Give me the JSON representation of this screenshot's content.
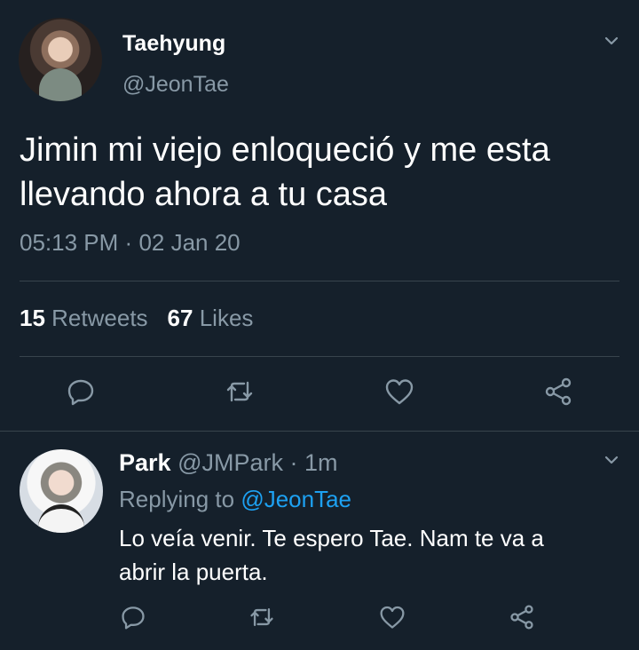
{
  "main_tweet": {
    "author_name": "Taehyung",
    "author_handle": "@JeonTae",
    "text": "Jimin mi viejo enloqueció y me esta\nllevando ahora a tu casa",
    "time": "05:13 PM",
    "separator": "·",
    "date": "02 Jan 20",
    "retweets_count": "15",
    "retweets_label": "Retweets",
    "likes_count": "67",
    "likes_label": "Likes"
  },
  "reply_tweet": {
    "author_name": "Park",
    "author_handle": "@JMPark",
    "separator": "·",
    "time_ago": "1m",
    "replying_prefix": "Replying to",
    "replying_to": "@JeonTae",
    "text": "Lo veía venir. Te espero Tae. Nam te va a\nabrir la puerta."
  },
  "icons": {
    "reply": "reply-icon",
    "retweet": "retweet-icon",
    "like": "heart-icon",
    "share": "share-icon",
    "more": "chevron-down-icon"
  },
  "colors": {
    "background": "#15202b",
    "text": "#ffffff",
    "secondary_text": "#8899a6",
    "link": "#1da1f2",
    "divider": "#38444d"
  }
}
